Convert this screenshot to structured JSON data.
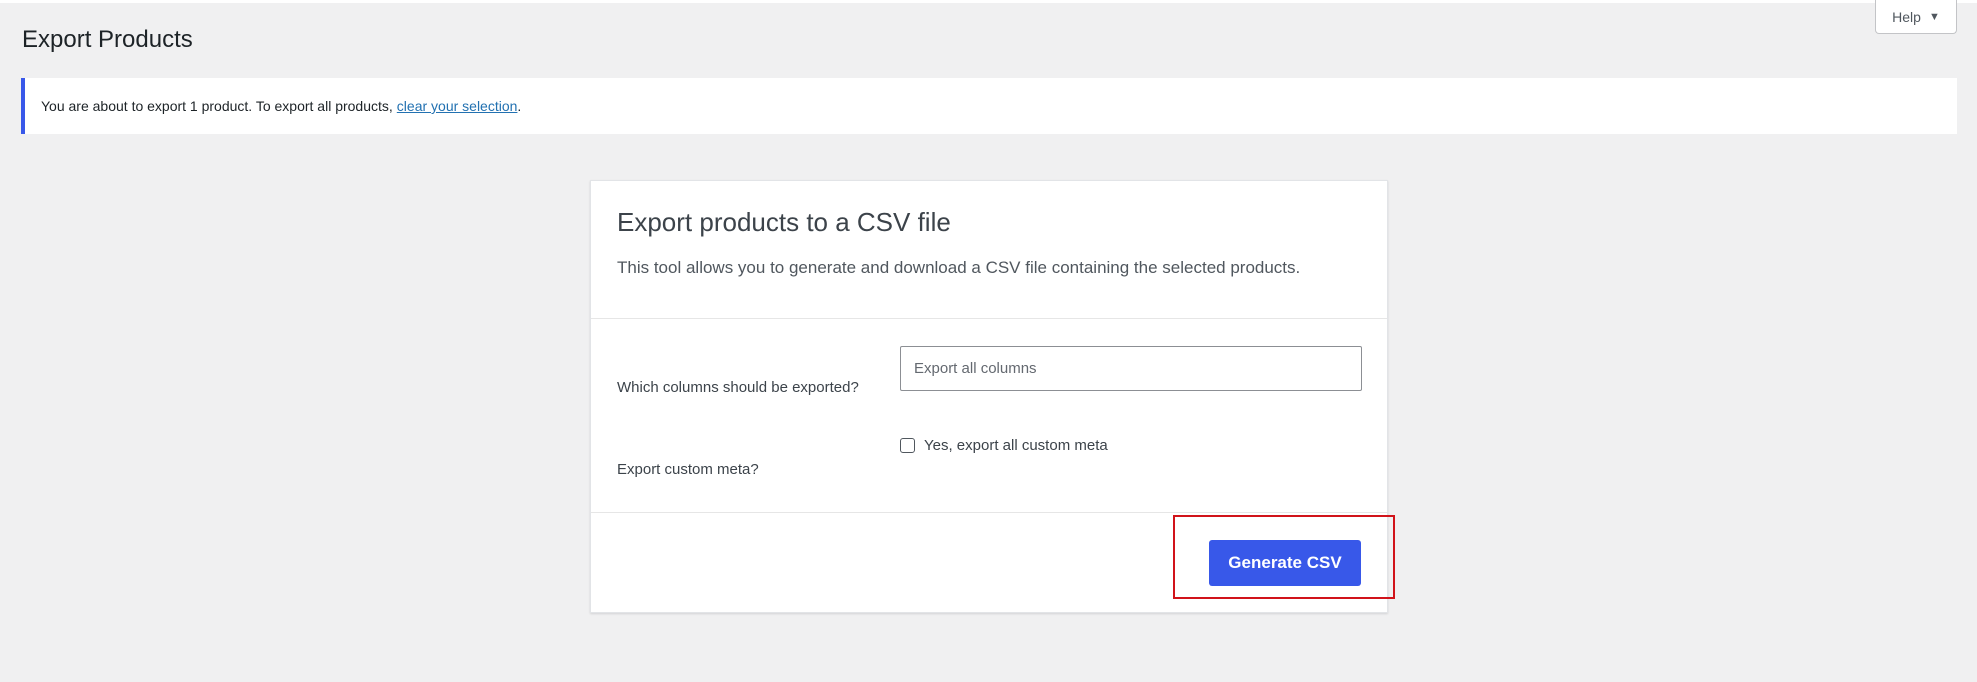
{
  "help_tab": {
    "label": "Help",
    "caret": "▼"
  },
  "page": {
    "title": "Export Products"
  },
  "notice": {
    "text": "You are about to export 1 product. To export all products,",
    "link_text": "clear your selection",
    "suffix": "."
  },
  "card": {
    "title": "Export products to a CSV file",
    "description": "This tool allows you to generate and download a CSV file containing the selected products.",
    "columns_label": "Which columns should be exported?",
    "columns_placeholder": "Export all columns",
    "meta_label": "Export custom meta?",
    "meta_checkbox_label": "Yes, export all custom meta",
    "meta_checked": false,
    "generate_button": "Generate CSV"
  },
  "colors": {
    "accent": "#3858e9",
    "highlight": "#d1131a",
    "background": "#f0f0f1",
    "link": "#2271b1"
  }
}
